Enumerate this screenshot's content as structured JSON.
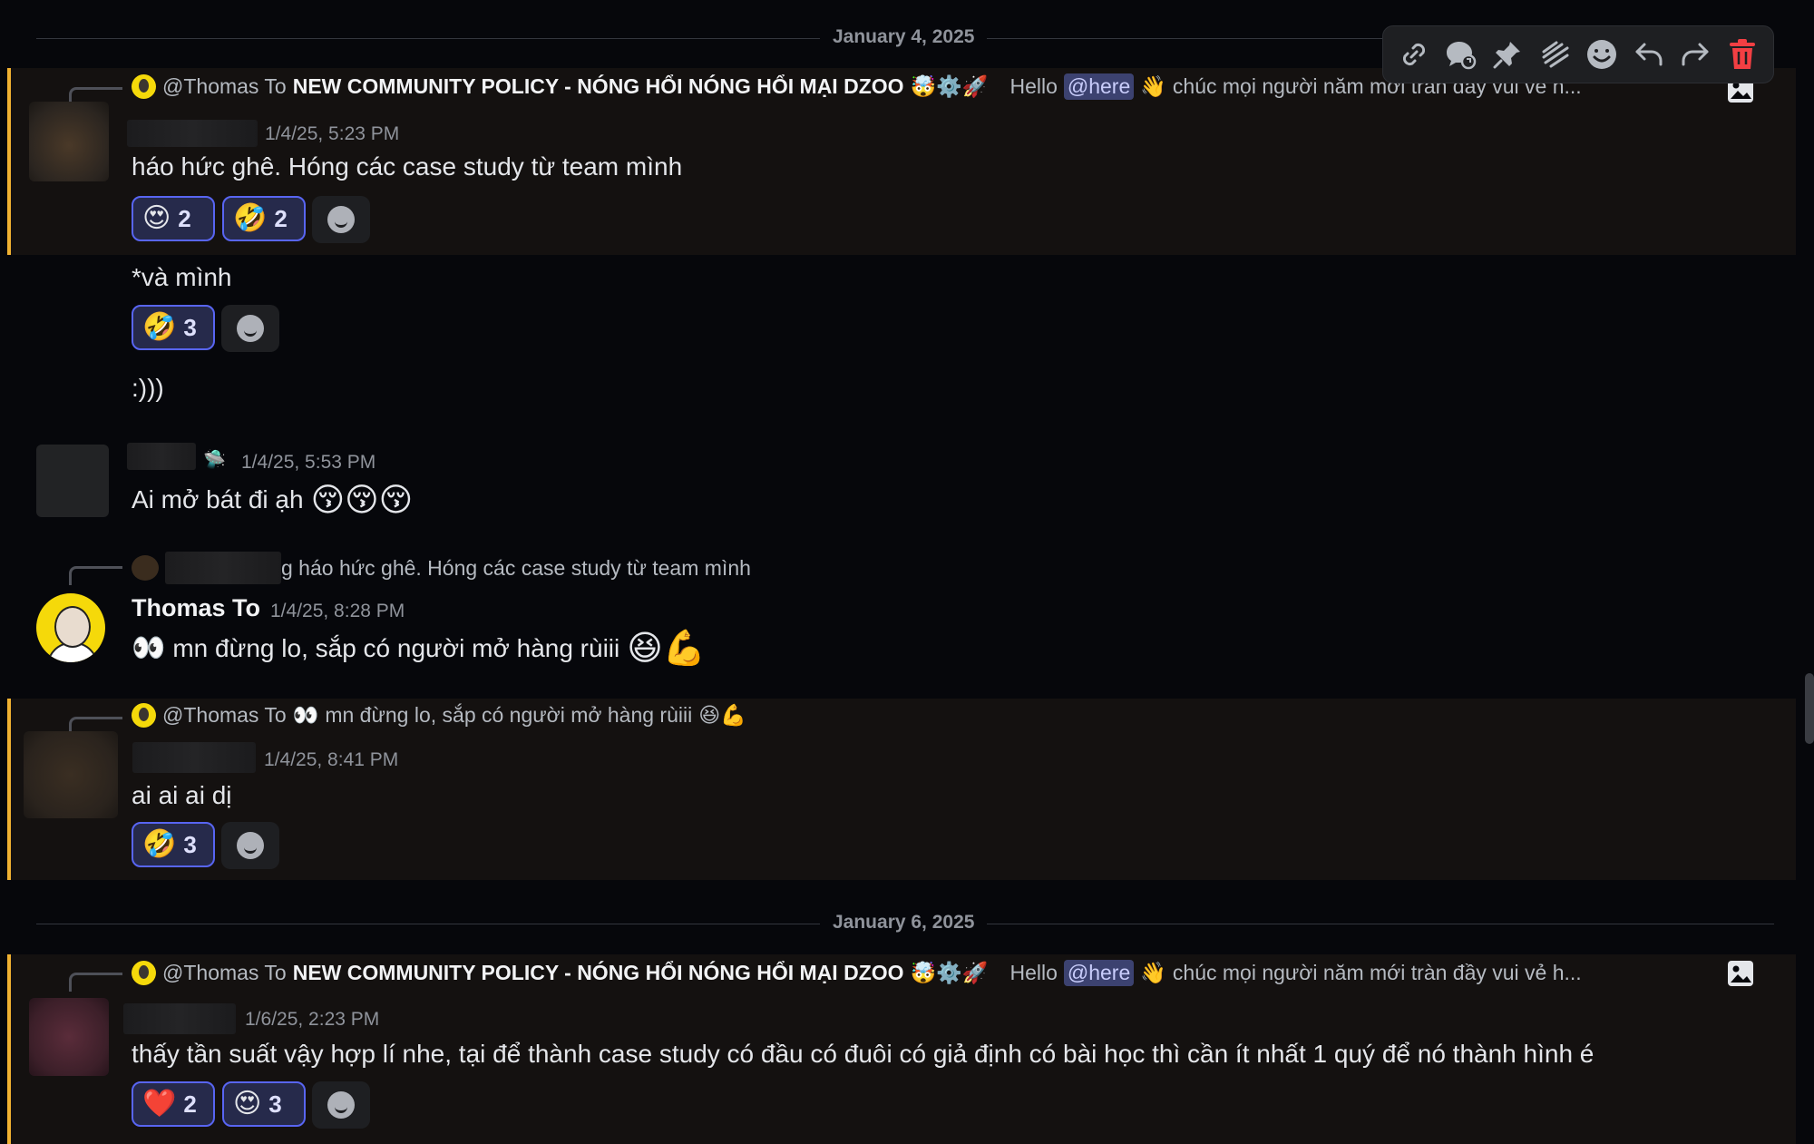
{
  "dividers": [
    "January 4, 2025",
    "January 6, 2025"
  ],
  "policy_reply": {
    "mention": "@Thomas To",
    "title": "NEW COMMUNITY POLICY - NÓNG HỔI NÓNG HỔI MẠI DZOO",
    "title_emojis": "🤯⚙️🚀",
    "hello": "Hello",
    "here": "@here",
    "wave": "👋",
    "preview_top": "chúc mọi người năm mới tràn đầy vui vẻ h...",
    "preview_bottom": "chúc mọi người năm mới tràn đầy vui vẻ h..."
  },
  "messages": [
    {
      "timestamp": "1/4/25, 5:23 PM",
      "text": "háo hức ghê. Hóng các case study từ team mình",
      "reactions": [
        {
          "emoji": "😍",
          "count": "2"
        },
        {
          "emoji": "🤣",
          "count": "2"
        }
      ]
    },
    {
      "text": "*và mình",
      "reactions": [
        {
          "emoji": "🤣",
          "count": "3"
        }
      ]
    },
    {
      "text": ":)))"
    },
    {
      "timestamp": "1/4/25, 5:53 PM",
      "badge": "🛸",
      "text": "Ai mở bát đi ạh",
      "emojis": "😚😚😚"
    },
    {
      "reply_suffix": "g háo hức ghê. Hóng các case study từ team mình",
      "username": "Thomas To",
      "timestamp": "1/4/25, 8:28 PM",
      "eyes": "👀",
      "text": "mn đừng lo, sắp có người mở hàng rùiii",
      "emojis": "😆💪"
    },
    {
      "reply_mention": "@Thomas To",
      "reply_eyes": "👀",
      "reply_text": "mn đừng lo, sắp có người mở hàng rùiii",
      "reply_emojis": "😆💪",
      "timestamp": "1/4/25, 8:41 PM",
      "text": "ai ai ai dị",
      "reactions": [
        {
          "emoji": "🤣",
          "count": "3"
        }
      ]
    },
    {
      "timestamp": "1/6/25, 2:23 PM",
      "text": "thấy tần suất vậy hợp lí nhe, tại để thành case study có đầu có đuôi có giả định có bài học thì cần ít nhất 1 quý để nó thành hình é",
      "reactions": [
        {
          "emoji": "❤️",
          "count": "2"
        },
        {
          "emoji": "😍",
          "count": "3"
        }
      ]
    }
  ],
  "toolbar": [
    "link-icon",
    "thread-icon",
    "pin-icon",
    "mark-unread-icon",
    "add-reaction-icon",
    "reply-icon",
    "forward-icon",
    "delete-icon"
  ],
  "colors": {
    "accent": "#5865f2",
    "highlight_bar": "#f0b232",
    "delete": "#f23f43"
  }
}
